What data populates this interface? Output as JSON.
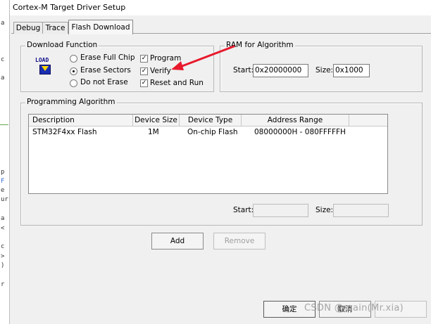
{
  "window": {
    "title": "Cortex-M Target Driver Setup"
  },
  "tabs": [
    "Debug",
    "Trace",
    "Flash Download"
  ],
  "download_function": {
    "legend": "Download Function",
    "icon_text": "LOAD",
    "erase_full_chip": "Erase Full Chip",
    "erase_sectors": "Erase Sectors",
    "do_not_erase": "Do not Erase",
    "program": "Program",
    "verify": "Verify",
    "reset_and_run": "Reset and Run",
    "selected_erase": "Erase Sectors",
    "program_checked": true,
    "verify_checked": true,
    "reset_checked": true
  },
  "ram": {
    "legend": "RAM for Algorithm",
    "start_label": "Start:",
    "start_value": "0x20000000",
    "size_label": "Size:",
    "size_value": "0x1000"
  },
  "programming_algorithm": {
    "legend": "Programming Algorithm",
    "columns": [
      "Description",
      "Device Size",
      "Device Type",
      "Address Range"
    ],
    "rows": [
      {
        "description": "STM32F4xx Flash",
        "device_size": "1M",
        "device_type": "On-chip Flash",
        "address_range": "08000000H - 080FFFFFH"
      }
    ],
    "start_label": "Start:",
    "start_value": "",
    "size_label": "Size:",
    "size_value": ""
  },
  "buttons": {
    "add": "Add",
    "remove": "Remove",
    "ok": "确定",
    "cancel": "取消"
  },
  "editor_gutter": [
    "a",
    "c",
    "a",
    "p",
    "F",
    "e",
    "ur",
    "a",
    "<",
    "c",
    ">",
    ")",
    "r"
  ],
  "watermark": "CSDN @main(Mr.xia)",
  "annotation": {
    "color": "#e8192c"
  }
}
